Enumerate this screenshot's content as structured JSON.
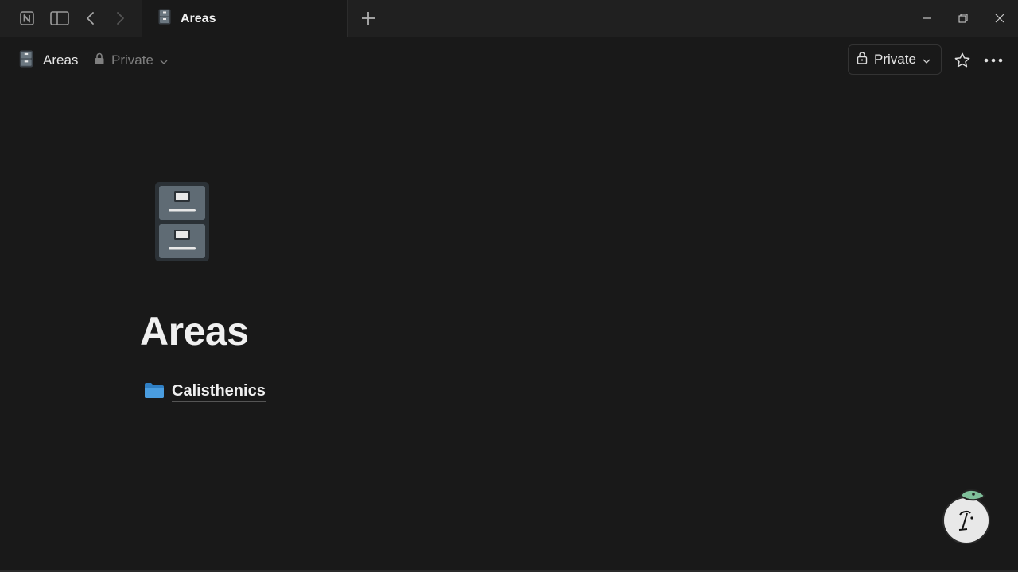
{
  "window": {
    "app_icon": "notion-logo-icon",
    "controls": [
      "minimize-icon",
      "restore-icon",
      "close-icon"
    ]
  },
  "tab": {
    "title": "Areas",
    "icon": "file-cabinet-icon"
  },
  "breadcrumb": {
    "title": "Areas",
    "icon": "file-cabinet-icon",
    "privacy_label": "Private"
  },
  "toolbar": {
    "share_label": "Private"
  },
  "page": {
    "title": "Areas",
    "icon": "file-cabinet-icon",
    "subpages": [
      {
        "label": "Calisthenics",
        "icon": "folder-icon"
      }
    ]
  },
  "colors": {
    "background": "#191919",
    "titlebar": "#202020",
    "text": "#f0f0f0",
    "muted": "#7f7f7f",
    "folder_blue": "#4a9de0",
    "cabinet_gray": "#5f6b74"
  }
}
